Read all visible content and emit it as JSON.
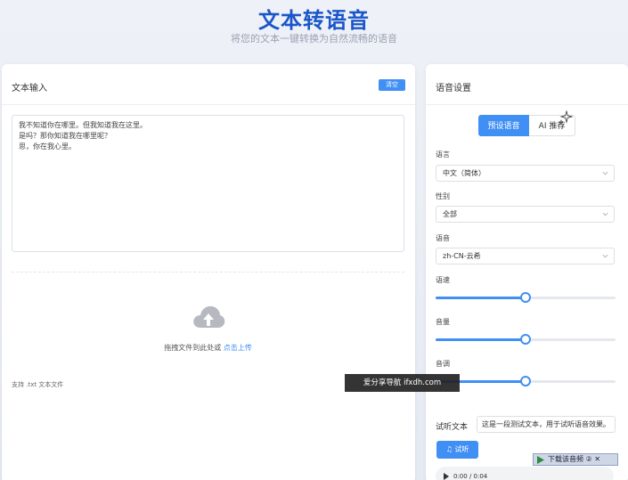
{
  "header": {
    "title": "文本转语音",
    "subtitle": "将您的文本一键转换为自然流畅的语音"
  },
  "text_input": {
    "title": "文本输入",
    "clear_label": "清空",
    "content": "我不知道你在哪里。但我知道我在这里。\n是吗？那你知道我在哪里呢？\n思，你在我心里。",
    "upload_text": "拖拽文件到此处或",
    "upload_link": "点击上传",
    "upload_hint": "支持 .txt 文本文件"
  },
  "voice_settings": {
    "title": "语音设置",
    "tabs": [
      {
        "label": "预设语音",
        "active": true
      },
      {
        "label": "AI 推荐",
        "active": false
      }
    ],
    "language": {
      "label": "语言",
      "value": "中文（简体）"
    },
    "gender": {
      "label": "性别",
      "value": "全部"
    },
    "voice": {
      "label": "语音",
      "value": "zh-CN-云希"
    },
    "rate": {
      "label": "语速",
      "fraction": 0.5
    },
    "volume": {
      "label": "音量",
      "fraction": 0.5
    },
    "pitch": {
      "label": "音调",
      "fraction": 0.5
    },
    "preview_label": "试听文本",
    "preview_text": "这是一段测试文本，用于试听语音效果。",
    "listen_label": "试听",
    "audio_time": "0:00 / 0:04"
  },
  "colors": {
    "accent": "#3f8ff5",
    "title": "#1a56c8"
  },
  "overlays": {
    "watermark": "爱分享导航 ifxdh.com",
    "download_badge": "下载该音频 ② ✕"
  }
}
